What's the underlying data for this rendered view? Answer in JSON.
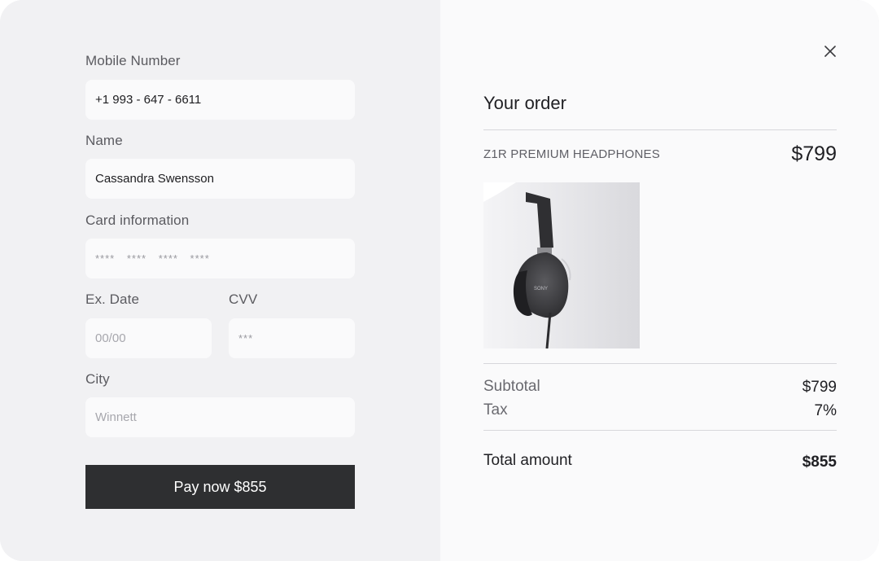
{
  "form": {
    "mobile": {
      "label": "Mobile Number",
      "value": "+1 993 - 647 - 6611"
    },
    "name": {
      "label": "Name",
      "value": "Cassandra Swensson"
    },
    "card": {
      "label": "Card information",
      "placeholder": "**** **** **** ****"
    },
    "exdate": {
      "label": "Ex. Date",
      "placeholder": "00/00"
    },
    "cvv": {
      "label": "CVV",
      "placeholder": "***"
    },
    "city": {
      "label": "City",
      "placeholder": "Winnett"
    },
    "pay_label": "Pay now $855"
  },
  "order": {
    "title": "Your order",
    "product": {
      "name": "Z1R PREMIUM HEADPHONES",
      "price": "$799",
      "brand_mark": "SONY"
    },
    "subtotal": {
      "label": "Subtotal",
      "value": "$799"
    },
    "tax": {
      "label": "Tax",
      "value": "7%"
    },
    "total": {
      "label": "Total amount",
      "value": "$855"
    }
  },
  "icons": {
    "close": "close-icon"
  },
  "colors": {
    "button_bg": "#2e2f31",
    "panel_left": "#f1f1f3",
    "panel_right": "#fafafb"
  }
}
